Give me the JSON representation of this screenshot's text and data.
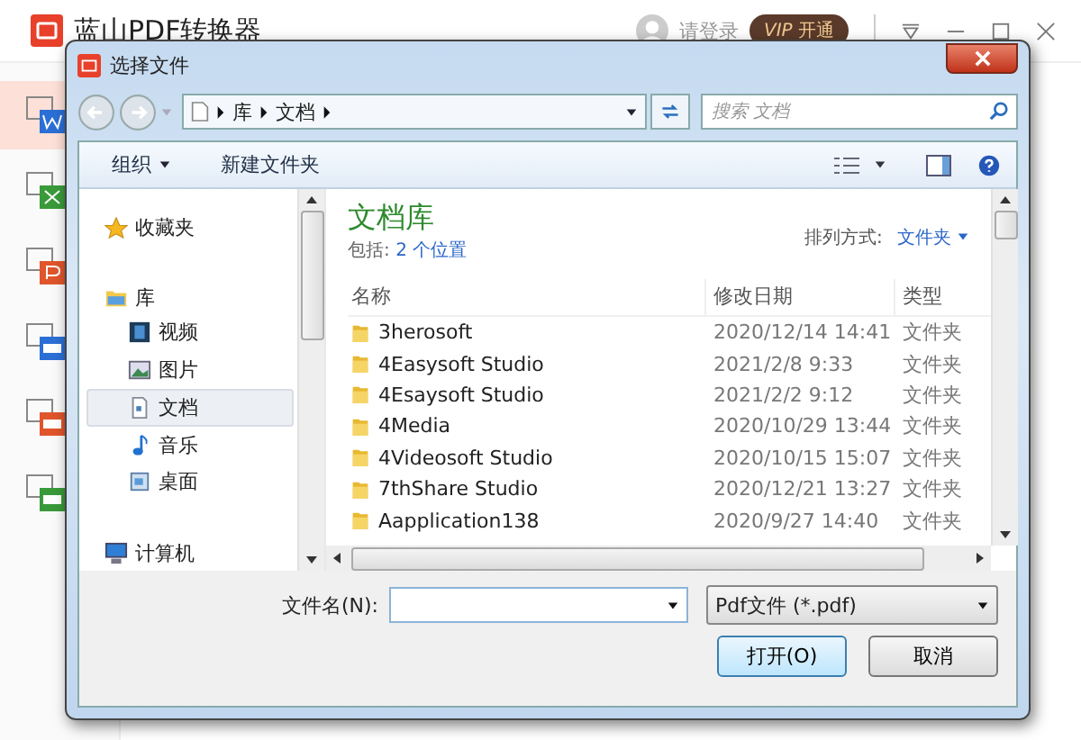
{
  "app": {
    "title": "蓝山PDF转换器",
    "login": "请登录",
    "vip": {
      "badge": "VIP",
      "action": "开通"
    },
    "sidebar": [
      {
        "kind": "word",
        "selected": true,
        "color": "#2b6fd6"
      },
      {
        "kind": "excel",
        "selected": false,
        "color": "#3a9a3a"
      },
      {
        "kind": "ppt",
        "selected": false,
        "color": "#e0552b"
      },
      {
        "kind": "pdf",
        "selected": false,
        "color": "#2b6fd6"
      },
      {
        "kind": "pdf",
        "selected": false,
        "color": "#e0552b"
      },
      {
        "kind": "pdf",
        "selected": false,
        "color": "#3a9a3a"
      }
    ]
  },
  "dialog": {
    "title": "选择文件",
    "breadcrumb": [
      "库",
      "文档"
    ],
    "search": {
      "placeholder": "搜索 文档"
    },
    "toolbar": [
      "组织",
      "新建文件夹"
    ],
    "nav": [
      {
        "kind": "favorites",
        "label": "收藏夹"
      },
      {
        "kind": "library",
        "label": "库",
        "children": [
          {
            "kind": "video",
            "label": "视频",
            "selected": false
          },
          {
            "kind": "image",
            "label": "图片",
            "selected": false
          },
          {
            "kind": "doc",
            "label": "文档",
            "selected": true
          },
          {
            "kind": "music",
            "label": "音乐",
            "selected": false
          },
          {
            "kind": "desktop",
            "label": "桌面",
            "selected": false
          }
        ]
      },
      {
        "kind": "computer",
        "label": "计算机"
      }
    ],
    "library": {
      "title": "文档库",
      "includes_label": "包括:",
      "includes_link": "2 个位置",
      "sort_label": "排列方式:",
      "sort_value": "文件夹"
    },
    "columns": [
      "名称",
      "修改日期",
      "类型"
    ],
    "rows": [
      {
        "name": "3herosoft",
        "date": "2020/12/14 14:41",
        "type": "文件夹"
      },
      {
        "name": "4Easysoft Studio",
        "date": "2021/2/8 9:33",
        "type": "文件夹"
      },
      {
        "name": "4Esaysoft Studio",
        "date": "2021/2/2 9:12",
        "type": "文件夹"
      },
      {
        "name": "4Media",
        "date": "2020/10/29 13:44",
        "type": "文件夹"
      },
      {
        "name": "4Videosoft Studio",
        "date": "2020/10/15 15:07",
        "type": "文件夹"
      },
      {
        "name": "7thShare Studio",
        "date": "2020/12/21 13:27",
        "type": "文件夹"
      },
      {
        "name": "Aapplication138",
        "date": "2020/9/27 14:40",
        "type": "文件夹"
      }
    ],
    "filename_label": "文件名(N):",
    "filetype": "Pdf文件 (*.pdf)",
    "buttons": [
      "打开(O)",
      "取消"
    ]
  }
}
